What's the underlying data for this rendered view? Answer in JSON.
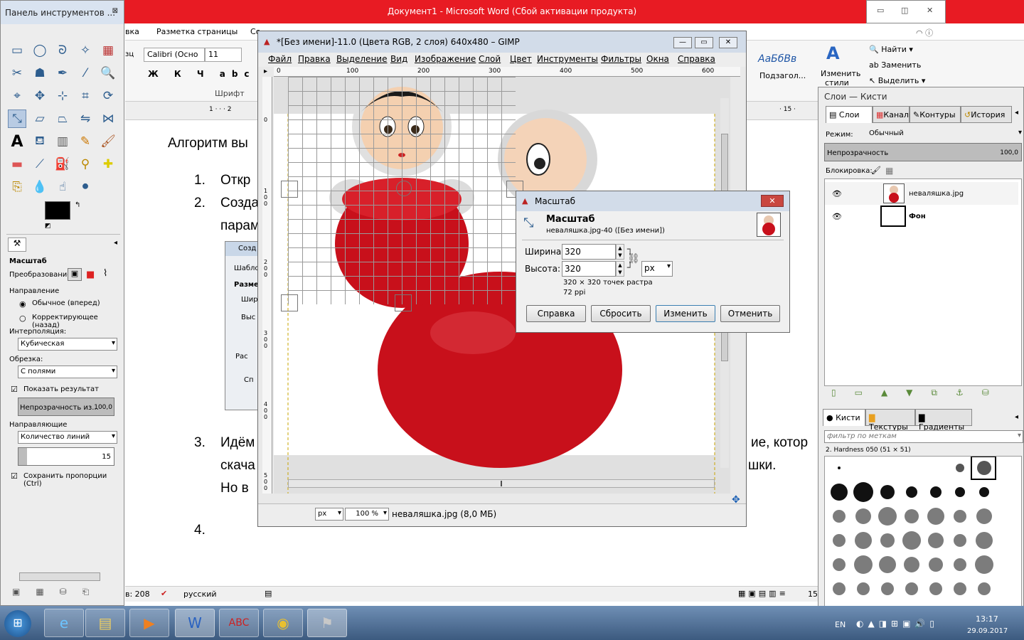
{
  "word": {
    "title": "Документ1 - Microsoft Word (Сбой активации продукта)",
    "tabs": [
      "вка",
      "Разметка страницы",
      "Сс"
    ],
    "font_name": "Calibri (Осно",
    "font_size": "11",
    "font_group": "Шрифт",
    "find": "Найти",
    "replace": "Заменить",
    "select": "Выделить",
    "change_styles_line1": "Изменить",
    "change_styles_line2": "стили",
    "style_sample": "АаБбВв",
    "style_label": "Подзагол...",
    "left_fragment": "зц",
    "doc_lines": [
      "Алгоритм вы",
      "1.",
      "Откр",
      "2.",
      "Созда",
      "парам",
      "3.",
      "Идём",
      "ие, котор",
      "скача",
      "шки.",
      "Но в",
      "4."
    ],
    "inner_dialog": {
      "title": "Созд",
      "l1": "Шабло",
      "l2": "Разме",
      "l3": "Шир",
      "l4": "Выс",
      "l5": "Рас",
      "btn": "Сп"
    },
    "status": {
      "words": "в: 208",
      "lang": "русский",
      "zoom": "15"
    }
  },
  "toolbox": {
    "title": "Панель инструментов ...",
    "options_title": "Масштаб",
    "transform_label": "Преобразование:",
    "direction_label": "Направление",
    "dir_normal": "Обычное (вперед)",
    "dir_corrective": "Корректирующее (назад)",
    "interp_label": "Интерполяция:",
    "interp_value": "Кубическая",
    "clip_label": "Обрезка:",
    "clip_value": "С полями",
    "show_preview": "Показать результат",
    "opacity_label": "Непрозрачность из...",
    "opacity_value": "100,0",
    "guides_label": "Направляющие",
    "guides_value": "Количество линий",
    "lines_value": "15",
    "keep_aspect": "Сохранить пропорции  (Ctrl)"
  },
  "gimp": {
    "title": "*[Без имени]-11.0 (Цвета RGB, 2 слоя) 640x480 – GIMP",
    "menu": [
      "Файл",
      "Правка",
      "Выделение",
      "Вид",
      "Изображение",
      "Слой",
      "Цвет",
      "Инструменты",
      "Фильтры",
      "Окна",
      "Справка"
    ],
    "ruler_h": [
      "0",
      "100",
      "200",
      "300",
      "400",
      "500",
      "600"
    ],
    "ruler_v": [
      "0",
      "100",
      "200",
      "300",
      "400",
      "500"
    ],
    "unit": "px",
    "zoom": "100 %",
    "status": "неваляшка.jpg (8,0 МБ)"
  },
  "scale_dialog": {
    "window_title": "Масштаб",
    "heading": "Масштаб",
    "subheading": "неваляшка.jpg-40 ([Без имени])",
    "width_label": "Ширина:",
    "width_value": "320",
    "height_label": "Высота:",
    "height_value": "320",
    "unit": "px",
    "info": "320 × 320 точек растра",
    "ppi": "72 ppi",
    "buttons": [
      "Справка",
      "Сбросить",
      "Изменить",
      "Отменить"
    ]
  },
  "layers": {
    "title": "Слои — Кисти",
    "tabs": [
      "Слои",
      "Каналы",
      "Контуры",
      "История"
    ],
    "mode_label": "Режим:",
    "mode_value": "Обычный",
    "opacity_label": "Непрозрачность",
    "opacity_value": "100,0",
    "lock_label": "Блокировка:",
    "items": [
      "неваляшка.jpg",
      "Фон"
    ],
    "brush_tabs": [
      "Кисти",
      "Текстуры",
      "Градиенты"
    ],
    "filter_placeholder": "фильтр по меткам",
    "brush_name": "2. Hardness 050 (51 × 51)"
  },
  "taskbar": {
    "lang": "EN",
    "time": "13:17",
    "date": "29.09.2017"
  },
  "colors": {
    "word_title": "#e81b23",
    "doll_red": "#c8101b",
    "gimp_title": "#d2dce9"
  }
}
